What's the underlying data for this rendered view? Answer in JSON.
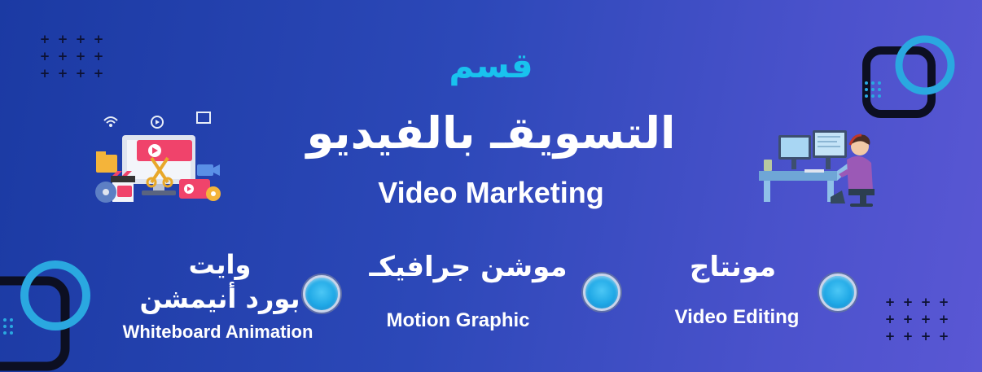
{
  "heading": {
    "small_ar": "قسم",
    "main_ar": "التسويقـ بالفيديو",
    "english": "Video Marketing"
  },
  "services": [
    {
      "arabic": "مونتاج",
      "english": "Video Editing"
    },
    {
      "arabic": "موشن جرافيكـ",
      "english": "Motion Graphic"
    },
    {
      "arabic_line1": "وايت",
      "arabic_line2": "بورد أنيمشن",
      "english": "Whiteboard Animation"
    }
  ],
  "decor": {
    "plus": "+"
  },
  "colors": {
    "accent": "#19c2ee",
    "bg_start": "#1b3aa3",
    "bg_end": "#5a57d4"
  },
  "icons": [
    "video-production-illustration",
    "video-editor-person-illustration",
    "bullet-icon",
    "frame-decoration-icon"
  ]
}
